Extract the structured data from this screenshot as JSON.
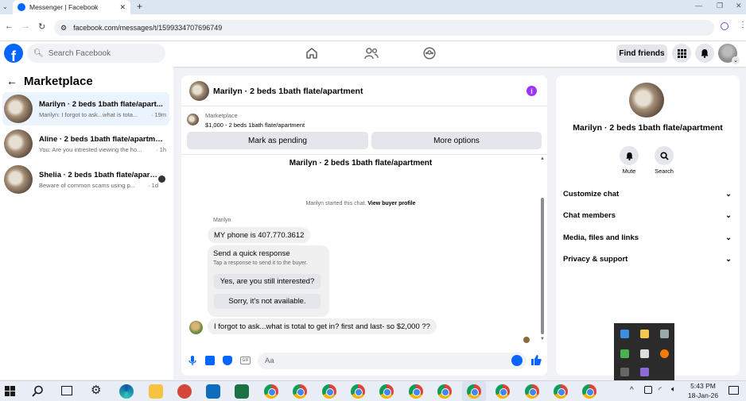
{
  "browser": {
    "tab_title": "Messenger | Facebook",
    "url": "facebook.com/messages/t/1599334707696749"
  },
  "header": {
    "search_placeholder": "Search Facebook",
    "find_friends": "Find friends"
  },
  "sidebar": {
    "title": "Marketplace",
    "conversations": [
      {
        "name": "Marilyn · 2 beds 1bath flate/apart...",
        "preview": "Marilyn: I forgot to ask...what is tota...",
        "time": "· 19m"
      },
      {
        "name": "Aline · 2 beds 1bath flate/apartment",
        "preview": "You: Are you intrested viewing the ho...",
        "time": "· 1h"
      },
      {
        "name": "Shelia · 2 beds 1bath flate/apart...",
        "preview": "Beware of common scams using p...",
        "time": "· 1d"
      }
    ]
  },
  "chat": {
    "title": "Marilyn · 2 beds 1bath flate/apartment",
    "listing_source": "Marketplace",
    "listing_price_title": "$1,000 - 2 beds 1bath flate/apartment",
    "btn_pending": "Mark as pending",
    "btn_more": "More options",
    "thread_heading": "Marilyn · 2 beds 1bath flate/apartment",
    "started_text": "Marilyn started this chat.",
    "view_profile": "View buyer profile",
    "sender_name": "Marilyn",
    "msg1": "MY phone is 407.770.3612",
    "quick_title": "Send a quick response",
    "quick_sub": "Tap a response to send it to the buyer.",
    "quick_opt1": "Yes, are you still interested?",
    "quick_opt2": "Sorry, it's not available.",
    "msg2": "I forgot to ask...what is total to get in?   first and last- so $2,000 ??",
    "composer_placeholder": "Aa"
  },
  "details": {
    "name": "Marilyn · 2 beds 1bath flate/apartment",
    "mute": "Mute",
    "search": "Search",
    "sections": [
      "Customize chat",
      "Chat members",
      "Media, files and links",
      "Privacy & support"
    ]
  },
  "taskbar": {
    "time": "5:43 PM",
    "date": "18-Jan-26"
  },
  "colors": {
    "fb_blue": "#0866ff",
    "purple_info": "#a033ff"
  }
}
